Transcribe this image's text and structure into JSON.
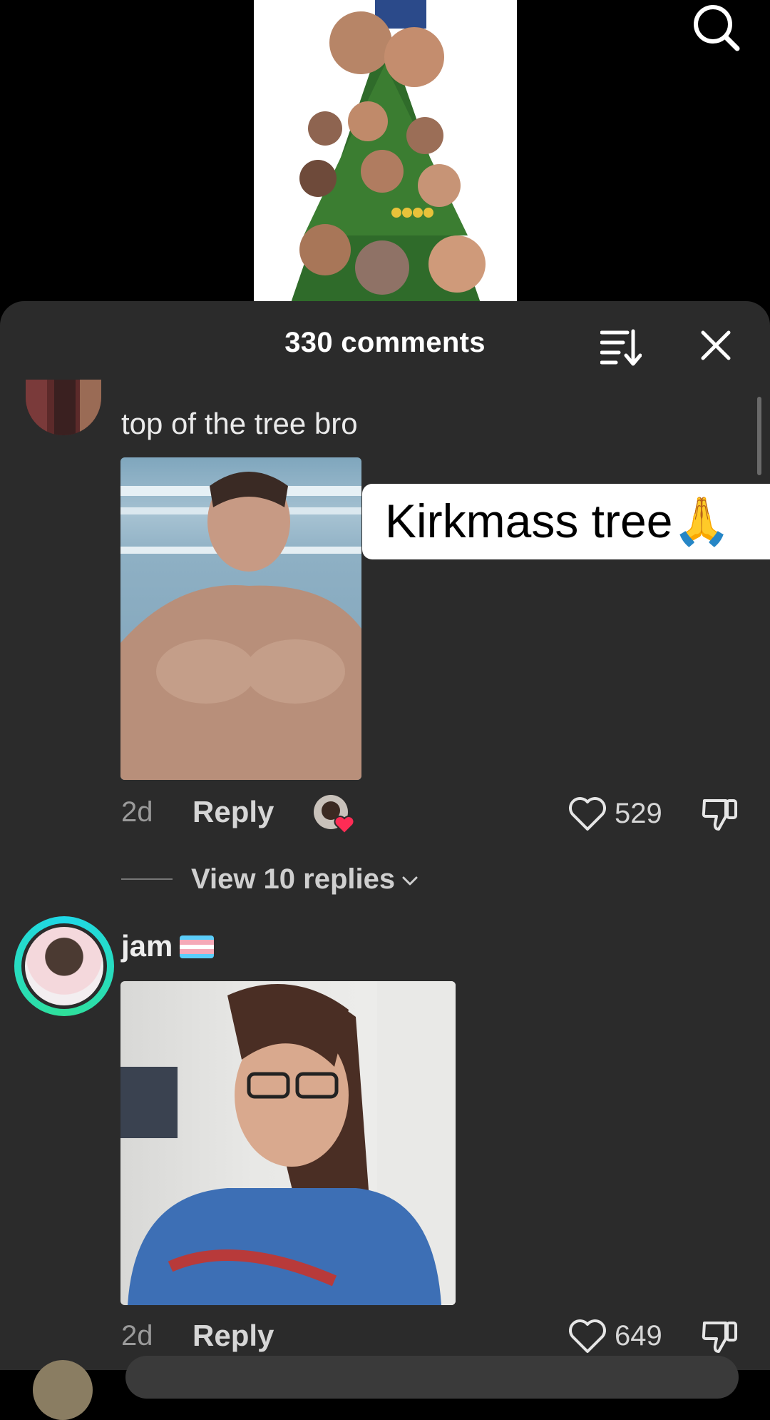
{
  "header": {
    "comment_count": "330 comments"
  },
  "video": {
    "caption": "Kirkmass tree🙏"
  },
  "comments": [
    {
      "text": "top of the tree bro",
      "age": "2d",
      "reply_label": "Reply",
      "likes": "529",
      "view_replies": "View 10 replies",
      "creator_liked": true
    },
    {
      "username": "jam",
      "age": "2d",
      "reply_label": "Reply",
      "likes": "649"
    }
  ],
  "icons": {
    "search": "search-icon",
    "sort": "sort-icon",
    "close": "close-icon",
    "like": "heart-outline-icon",
    "dislike": "thumbs-down-icon",
    "chevron": "chevron-down-icon"
  },
  "colors": {
    "sheet_bg": "#2b2b2b",
    "creator_heart": "#fe2c55",
    "avatar_ring": "#1fd8e8"
  }
}
